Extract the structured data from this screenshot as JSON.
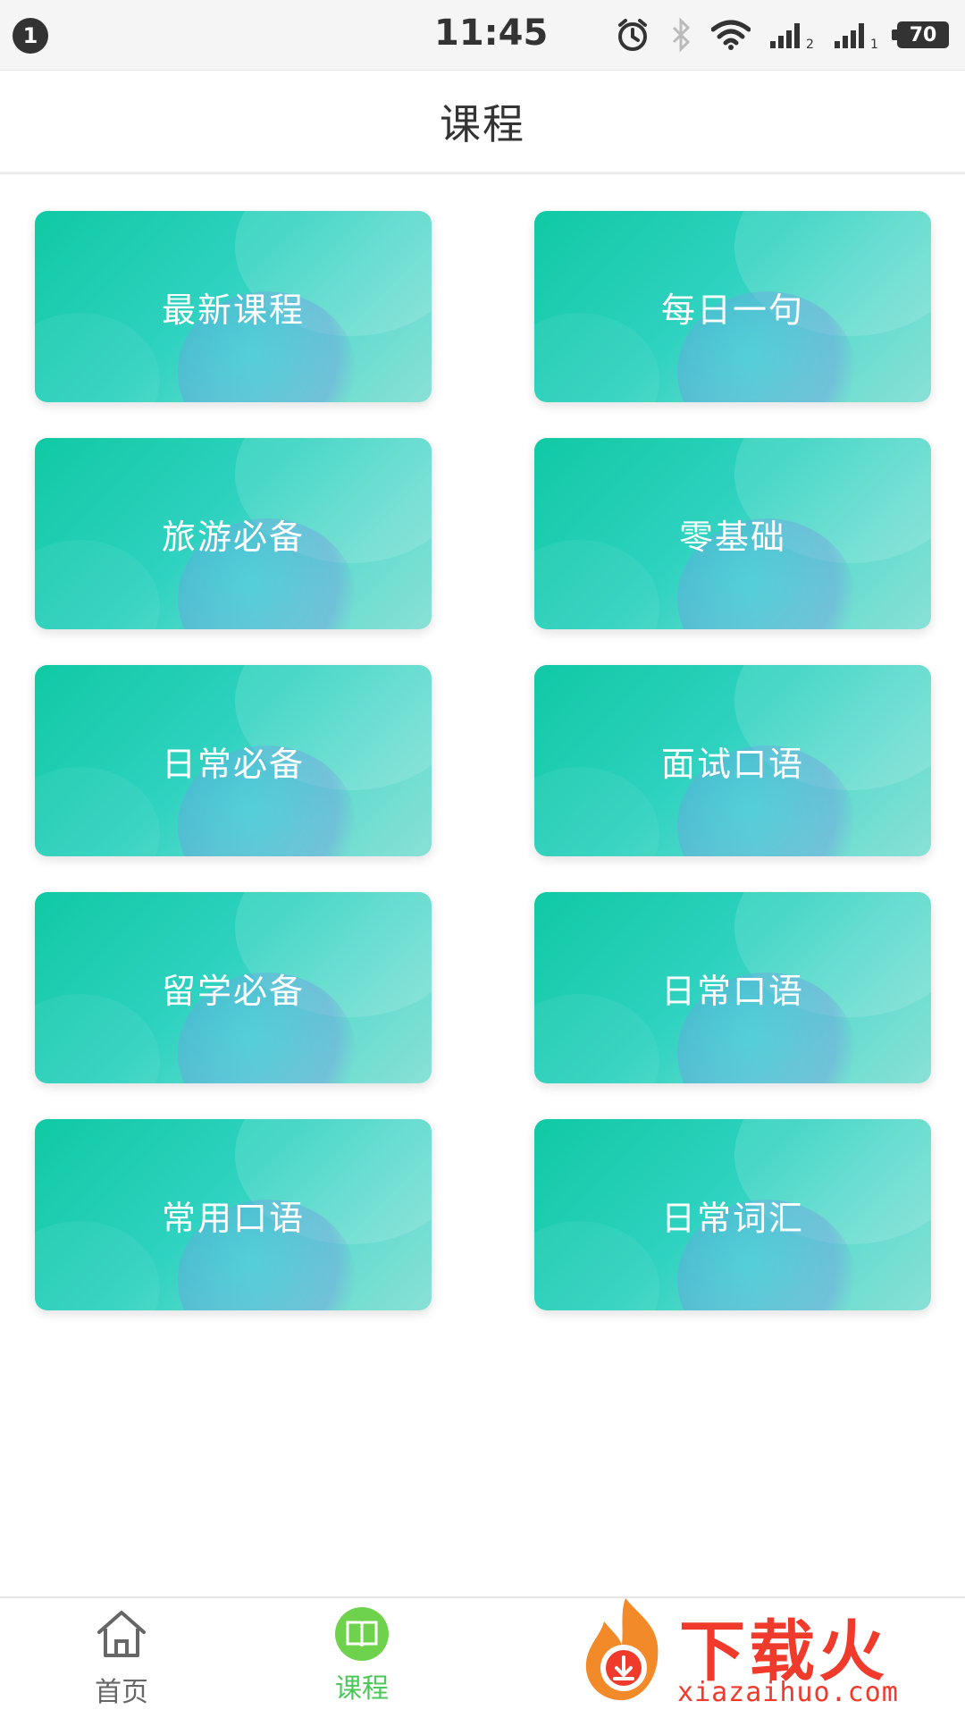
{
  "status_bar": {
    "notification_count": "1",
    "time": "11:45",
    "battery": "70",
    "icons": [
      "alarm-icon",
      "bluetooth-icon",
      "wifi-icon",
      "signal-1-icon",
      "signal-2-icon",
      "battery-icon"
    ]
  },
  "header": {
    "title": "课程"
  },
  "courses": [
    {
      "label": "最新课程"
    },
    {
      "label": "每日一句"
    },
    {
      "label": "旅游必备"
    },
    {
      "label": "零基础"
    },
    {
      "label": "日常必备"
    },
    {
      "label": "面试口语"
    },
    {
      "label": "留学必备"
    },
    {
      "label": "日常口语"
    },
    {
      "label": "常用口语"
    },
    {
      "label": "日常词汇"
    }
  ],
  "bottom_nav": {
    "items": [
      {
        "label": "首页",
        "icon": "home-icon",
        "active": false
      },
      {
        "label": "课程",
        "icon": "book-icon",
        "active": true
      }
    ],
    "active_color": "#4cc75a"
  },
  "watermark": {
    "text": "下载火",
    "url": "xiazaihuo.com"
  },
  "colors": {
    "card_gradient_start": "#10c9a4",
    "card_gradient_end": "#8ae0d6"
  }
}
